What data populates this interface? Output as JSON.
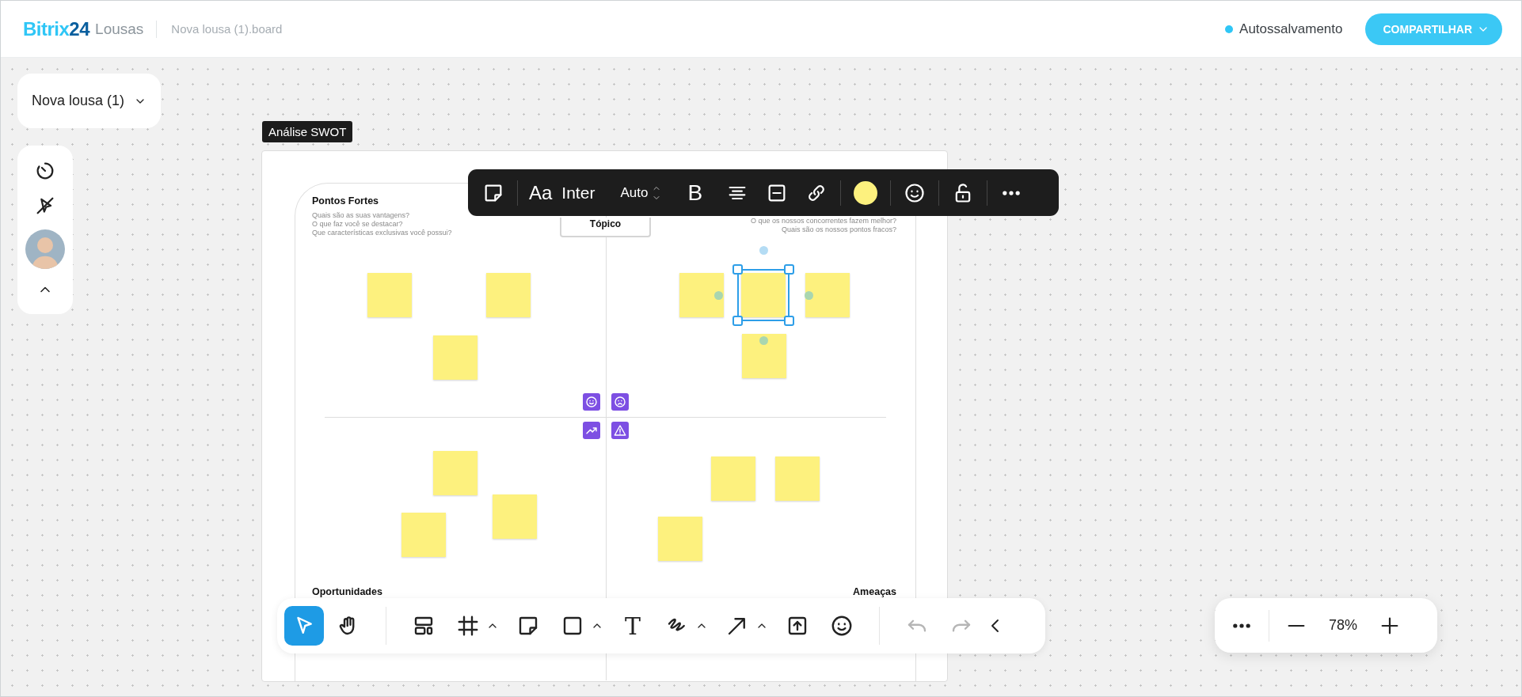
{
  "header": {
    "logo": {
      "name": "Bitrix",
      "number": "24",
      "product": "Lousas"
    },
    "file_name": "Nova lousa (1).board",
    "autosave": "Autossalvamento",
    "share_button": "COMPARTILHAR"
  },
  "board_menu": {
    "label": "Nova lousa (1)"
  },
  "frame": {
    "title": "Análise SWOT",
    "topic": "Tópico",
    "quadrants": [
      {
        "title": "Pontos Fortes",
        "questions": [
          "Quais são as suas vantagens?",
          " O que faz você se destacar?",
          "Que características exclusivas você possui?"
        ]
      },
      {
        "questions": [
          "O que os nossos concorrentes fazem melhor?",
          "Quais são os nossos pontos fracos?"
        ]
      },
      {
        "title": "Oportunidades"
      },
      {
        "title": "Ameaças"
      }
    ],
    "stickies": [
      {
        "selected": false
      },
      {
        "selected": false
      },
      {
        "selected": false
      },
      {
        "selected": false
      },
      {
        "selected": true
      },
      {
        "selected": false
      },
      {
        "selected": false
      },
      {
        "selected": false
      },
      {
        "selected": false
      },
      {
        "selected": false
      },
      {
        "selected": false
      },
      {
        "selected": false
      },
      {
        "selected": false
      }
    ]
  },
  "context_toolbar": {
    "font_icon": "Aa",
    "font": "Inter",
    "size": "Auto",
    "bold_icon": "B"
  },
  "bottom_toolbar": {
    "groups": [
      [
        {
          "kind": "select",
          "selected": true,
          "expandable": false
        },
        {
          "kind": "hand",
          "selected": false,
          "expandable": false
        }
      ],
      [
        {
          "kind": "templates",
          "selected": false,
          "expandable": false
        },
        {
          "kind": "frame",
          "selected": false,
          "expandable": true
        },
        {
          "kind": "sticky",
          "selected": false,
          "expandable": false
        },
        {
          "kind": "shape",
          "selected": false,
          "expandable": true
        },
        {
          "kind": "text",
          "glyph": "T",
          "selected": false,
          "expandable": false
        },
        {
          "kind": "pen",
          "selected": false,
          "expandable": true
        },
        {
          "kind": "arrow",
          "selected": false,
          "expandable": true
        },
        {
          "kind": "upload",
          "selected": false,
          "expandable": false
        },
        {
          "kind": "emoji",
          "selected": false,
          "expandable": false
        }
      ],
      [
        {
          "kind": "undo",
          "disabled": true
        },
        {
          "kind": "redo",
          "disabled": true
        },
        {
          "kind": "collapse",
          "disabled": false
        }
      ]
    ]
  },
  "zoom": {
    "value": "78%"
  }
}
